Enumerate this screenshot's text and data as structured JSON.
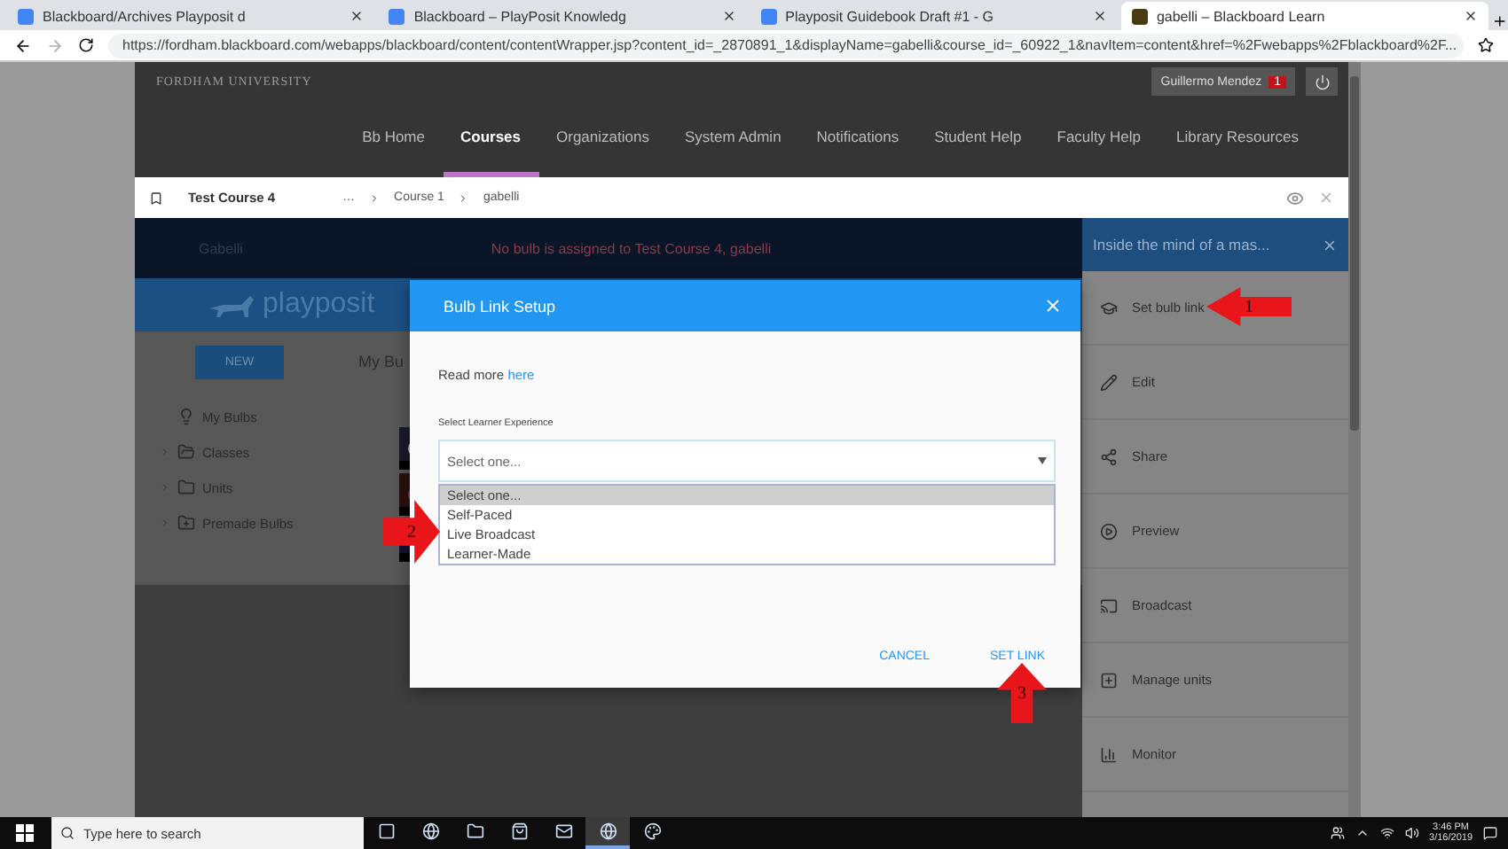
{
  "browser": {
    "tabs": [
      {
        "title": "Blackboard/Archives Playposit d",
        "selected": false
      },
      {
        "title": "Blackboard – PlayPosit Knowledg",
        "selected": false
      },
      {
        "title": "Playposit Guidebook Draft #1 - G",
        "selected": false
      },
      {
        "title": "gabelli – Blackboard Learn",
        "selected": true
      }
    ],
    "url": "https://fordham.blackboard.com/webapps/blackboard/content/contentWrapper.jsp?content_id=_2870891_1&displayName=gabelli&course_id=_60922_1&navItem=content&href=%2Fwebapps%2Fblackboard%2F..."
  },
  "header": {
    "institution": "FORDHAM UNIVERSITY",
    "user": "Guillermo Mendez",
    "badge": "1",
    "nav": [
      {
        "label": "Bb Home",
        "selected": false
      },
      {
        "label": "Courses",
        "selected": true
      },
      {
        "label": "Organizations",
        "selected": false
      },
      {
        "label": "System Admin",
        "selected": false
      },
      {
        "label": "Notifications",
        "selected": false
      },
      {
        "label": "Student Help",
        "selected": false
      },
      {
        "label": "Faculty Help",
        "selected": false
      },
      {
        "label": "Library Resources",
        "selected": false
      }
    ]
  },
  "course_bar": {
    "course": "Test Course 4",
    "crumbs": [
      "…",
      "Course 1",
      "gabelli"
    ]
  },
  "banner": {
    "title": "Gabelli",
    "message": "No bulb is assigned to Test Course 4, gabelli"
  },
  "playposit": {
    "logo": "playposit",
    "new_button": "NEW",
    "tab": "My Bu",
    "tree": [
      {
        "label": "My Bulbs",
        "kind": "bulb",
        "expandable": false
      },
      {
        "label": "Classes",
        "kind": "classes",
        "expandable": true
      },
      {
        "label": "Units",
        "kind": "folder",
        "expandable": true
      },
      {
        "label": "Premade Bulbs",
        "kind": "premade",
        "expandable": true
      }
    ]
  },
  "dialog": {
    "title": "Bulb Link Setup",
    "intro": "Read more",
    "link": "here",
    "field_label": "Select Learner Experience",
    "select": {
      "value": "Select one...",
      "options": [
        {
          "label": "Select one...",
          "selected": true
        },
        {
          "label": "Self-Paced",
          "selected": false
        },
        {
          "label": "Live Broadcast",
          "selected": false
        },
        {
          "label": "Learner-Made",
          "selected": false
        }
      ]
    },
    "buttons": [
      "CANCEL",
      "SET LINK"
    ]
  },
  "side_panel": {
    "title": "Inside the mind of a mas...",
    "items": [
      {
        "label": "Set bulb link",
        "kind": "link"
      },
      {
        "label": "Edit",
        "kind": "edit"
      },
      {
        "label": "Share",
        "kind": "share"
      },
      {
        "label": "Preview",
        "kind": "preview"
      },
      {
        "label": "Broadcast",
        "kind": "broadcast"
      },
      {
        "label": "Manage units",
        "kind": "units"
      },
      {
        "label": "Monitor",
        "kind": "monitor"
      }
    ]
  },
  "annotations": [
    {
      "label": "1",
      "kind": "left"
    },
    {
      "label": "2",
      "kind": "right"
    },
    {
      "label": "3",
      "kind": "up"
    }
  ],
  "taskbar": {
    "search_placeholder": "Type here to search",
    "apps": [
      {
        "kind": "taskview",
        "active": false
      },
      {
        "kind": "edge",
        "active": false
      },
      {
        "kind": "explorer",
        "active": false
      },
      {
        "kind": "store",
        "active": false
      },
      {
        "kind": "mail",
        "active": false
      },
      {
        "kind": "chrome",
        "active": true
      },
      {
        "kind": "paint",
        "active": false
      }
    ],
    "time": "3:46 PM",
    "date": "3/16/2019"
  }
}
